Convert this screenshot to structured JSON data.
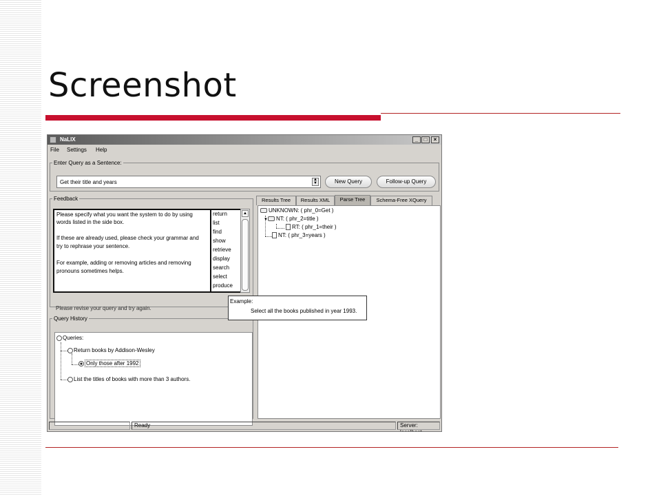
{
  "slide": {
    "title": "Screenshot"
  },
  "window": {
    "title": "NaLIX",
    "controls": {
      "minimize": "_",
      "maximize": "□",
      "close": "×"
    }
  },
  "menu": [
    "File",
    "Settings",
    "Help"
  ],
  "query": {
    "legend": "Enter Query as a Sentence:",
    "value": "Get their title and years",
    "new_button": "New Query",
    "followup_button": "Follow-up Query"
  },
  "feedback": {
    "legend": "Feedback",
    "lines": [
      "Please specify what you want the system to do by using",
      "words listed in the side box.",
      "",
      "If these are already used, please check your grammar and",
      "try to rephrase your sentence.",
      "",
      "For example, adding or removing articles and removing",
      "pronouns sometimes helps."
    ],
    "verbs": [
      "return",
      "list",
      "find",
      "show",
      "retrieve",
      "display",
      "search",
      "select",
      "produce"
    ],
    "revise": "Please revise your query and try again."
  },
  "tooltip": {
    "label": "Example:",
    "text": "Select all the books published in year 1993."
  },
  "history": {
    "legend": "Query History",
    "root": "Queries:",
    "items": [
      "Return books by Addison-Wesley",
      "Only those after 1992",
      "List the titles of books with more than 3 authors."
    ]
  },
  "tabs": [
    "Results Tree",
    "Results XML",
    "Parse Tree",
    "Schema-Free XQuery"
  ],
  "active_tab": "Parse Tree",
  "parse_tree": [
    "UNKNOWN:  ( phr_0=Get )",
    "NT:  ( phr_2=title )",
    "RT:  ( phr_1=their )",
    "NT:  ( phr_3=years )"
  ],
  "status": {
    "left": "",
    "middle": "Ready",
    "right": "Server: localhost"
  }
}
